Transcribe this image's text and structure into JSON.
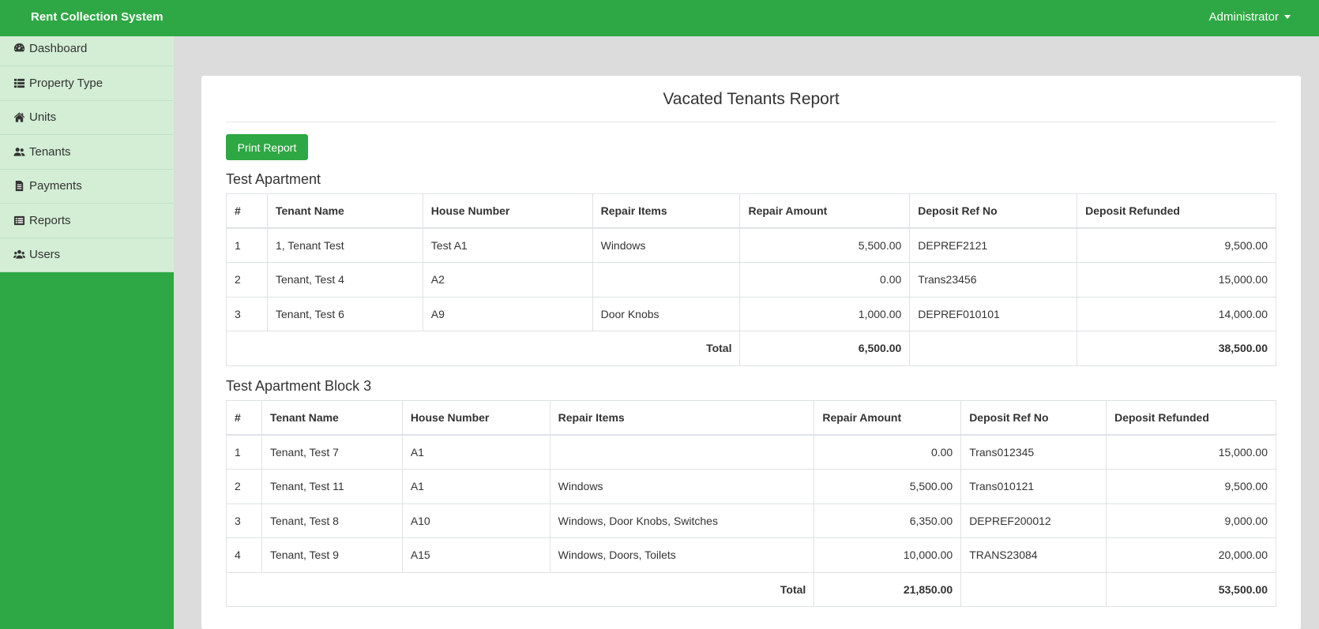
{
  "app": {
    "title": "Rent Collection System",
    "user": "Administrator"
  },
  "colors": {
    "brand_green": "#2ea844",
    "sidebar_menu_bg": "#d3eed5",
    "page_bg": "#dcdcdc"
  },
  "sidebar": {
    "items": [
      {
        "label": "Dashboard",
        "icon": "dashboard-icon"
      },
      {
        "label": "Property Type",
        "icon": "list-icon"
      },
      {
        "label": "Units",
        "icon": "home-icon"
      },
      {
        "label": "Tenants",
        "icon": "user-group-icon"
      },
      {
        "label": "Payments",
        "icon": "receipt-icon"
      },
      {
        "label": "Reports",
        "icon": "report-icon"
      },
      {
        "label": "Users",
        "icon": "users-icon"
      }
    ]
  },
  "report": {
    "title": "Vacated Tenants Report",
    "print_label": "Print Report",
    "columns": [
      "#",
      "Tenant Name",
      "House Number",
      "Repair Items",
      "Repair Amount",
      "Deposit Ref No",
      "Deposit Refunded"
    ],
    "total_label": "Total",
    "groups": [
      {
        "name": "Test Apartment",
        "rows": [
          [
            "1",
            "1, Tenant Test",
            "Test A1",
            "Windows",
            "5,500.00",
            "DEPREF2121",
            "9,500.00"
          ],
          [
            "2",
            "Tenant, Test 4",
            "A2",
            "",
            "0.00",
            "Trans23456",
            "15,000.00"
          ],
          [
            "3",
            "Tenant, Test 6",
            "A9",
            "Door Knobs",
            "1,000.00",
            "DEPREF010101",
            "14,000.00"
          ]
        ],
        "total_repair": "6,500.00",
        "total_refunded": "38,500.00"
      },
      {
        "name": "Test Apartment Block 3",
        "rows": [
          [
            "1",
            "Tenant, Test 7",
            "A1",
            "",
            "0.00",
            "Trans012345",
            "15,000.00"
          ],
          [
            "2",
            "Tenant, Test 11",
            "A1",
            "Windows",
            "5,500.00",
            "Trans010121",
            "9,500.00"
          ],
          [
            "3",
            "Tenant, Test 8",
            "A10",
            "Windows, Door Knobs, Switches",
            "6,350.00",
            "DEPREF200012",
            "9,000.00"
          ],
          [
            "4",
            "Tenant, Test 9",
            "A15",
            "Windows, Doors, Toilets",
            "10,000.00",
            "TRANS23084",
            "20,000.00"
          ]
        ],
        "total_repair": "21,850.00",
        "total_refunded": "53,500.00"
      }
    ]
  }
}
